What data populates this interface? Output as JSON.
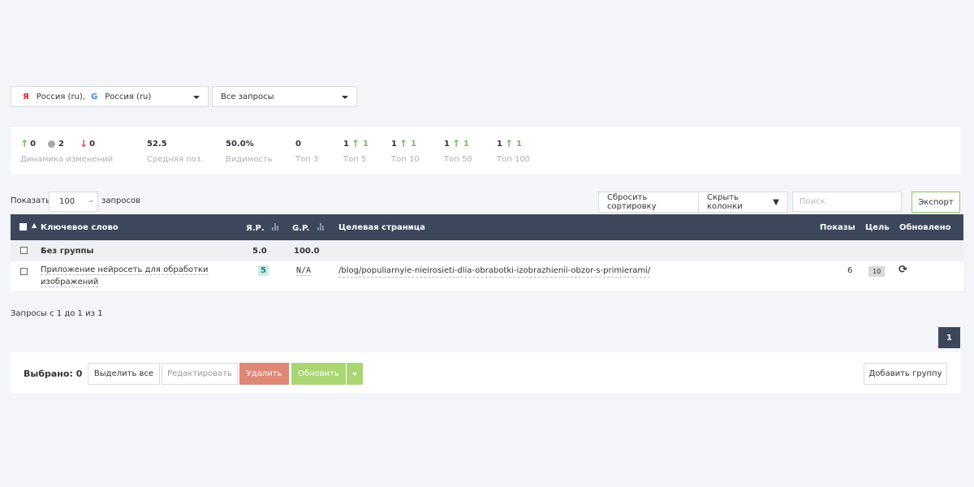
{
  "filters": {
    "region": {
      "yandex": "Россия (ru),",
      "google": "Россия (ru)"
    },
    "queries": "Все запросы"
  },
  "stats": {
    "dynamics": {
      "up": "0",
      "neutral": "2",
      "down": "0",
      "label": "Динамика изменений"
    },
    "avg_pos": {
      "value": "52.5",
      "label": "Средняя поз."
    },
    "visibility": {
      "value": "50.0%",
      "label": "Видимость"
    },
    "top3": {
      "value": "0",
      "label": "Топ 3"
    },
    "top5": {
      "value": "1",
      "delta": "1",
      "label": "Топ 5"
    },
    "top10": {
      "value": "1",
      "delta": "1",
      "label": "Топ 10"
    },
    "top50": {
      "value": "1",
      "delta": "1",
      "label": "Топ 50"
    },
    "top100": {
      "value": "1",
      "delta": "1",
      "label": "Топ 100"
    }
  },
  "toolbar": {
    "show_label": "Показать",
    "page_size": "100",
    "queries_label": "запросов",
    "reset_sort": "Сбросить сортировку",
    "hide_columns": "Скрыть колонки",
    "hide_columns_caret": "▼",
    "search_placeholder": "Поиск",
    "export": "Экспорт"
  },
  "table": {
    "headers": {
      "keyword": "Ключевое слово",
      "yp": "Я.Р.",
      "gp": "G.P.",
      "target_page": "Целевая страница",
      "impressions": "Показы",
      "goal": "Цель",
      "updated": "Обновлено"
    },
    "group": {
      "name": "Без группы",
      "yp": "5.0",
      "gp": "100.0"
    },
    "rows": [
      {
        "keyword_line1": "Приложение нейросеть для обработки",
        "keyword_line2": "изображений",
        "yp": "5",
        "gp": "N/A",
        "url": "/blog/populiarnyie-nieirosieti-dlia-obrabotki-izobrazhienii-obzor-s-primierami/",
        "impressions": "6",
        "goal": "10"
      }
    ]
  },
  "pagination": {
    "range_text": "Запросы с 1 до 1 из 1",
    "current_page": "1"
  },
  "bottom": {
    "selected": "Выбрано: 0",
    "select_all": "Выделить все",
    "edit": "Редактировать",
    "delete": "Удалить",
    "update": "Обновить",
    "add_group": "Добавить группу"
  },
  "colors": {
    "header_bg": "#3d475c",
    "green": "#6ac259",
    "red": "#e8444b",
    "delete_btn": "#df8775",
    "update_btn": "#a9d573"
  }
}
